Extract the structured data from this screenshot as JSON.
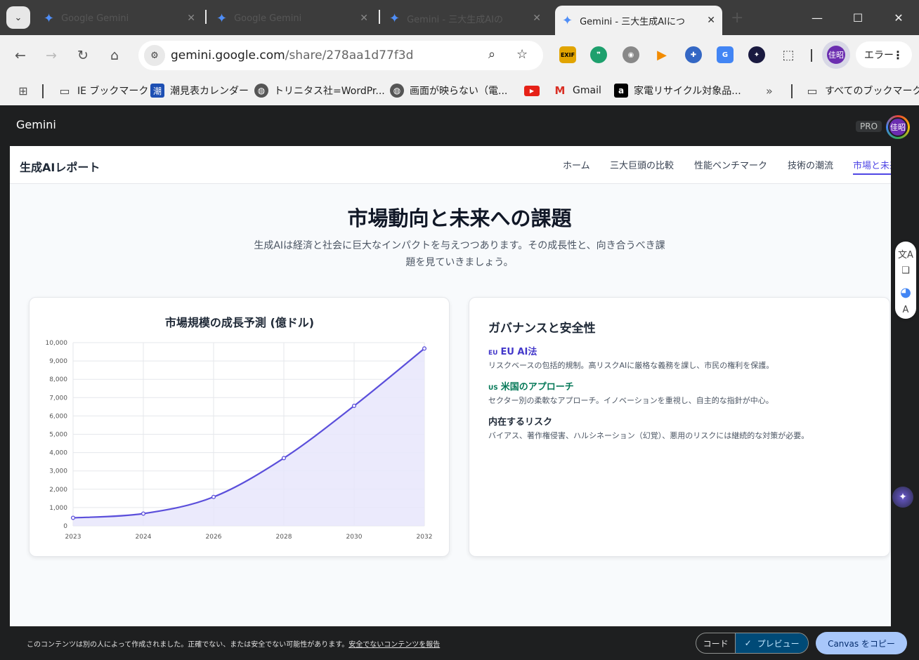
{
  "browser": {
    "tabs": [
      {
        "title": "Google Gemini",
        "active": false
      },
      {
        "title": "Google Gemini",
        "active": false
      },
      {
        "title": "Gemini - 三大生成AIの",
        "active": false
      },
      {
        "title": "Gemini - 三大生成AIにつ",
        "active": true
      }
    ],
    "url_host": "gemini.google.com",
    "url_path": "/share/278aa1d77f3d",
    "profile_initials": "佳昭",
    "error_label": "エラー",
    "extensions": [
      "EXIF",
      "❞",
      "◉",
      "▶",
      "✚",
      "G",
      "✦",
      "⬚"
    ]
  },
  "bookmarks": [
    {
      "icon": "folder-icon",
      "label": "IE ブックマーク"
    },
    {
      "icon": "tide-icon",
      "glyph": "潮",
      "label": "潮見表カレンダー"
    },
    {
      "icon": "globe-icon",
      "label": "トリニタス社=WordPr..."
    },
    {
      "icon": "globe-icon",
      "label": "画面が映らない（電..."
    },
    {
      "icon": "youtube-icon",
      "label": ""
    },
    {
      "icon": "gmail-icon",
      "label": "Gmail"
    },
    {
      "icon": "amazon-icon",
      "glyph": "a",
      "label": "家電リサイクル対象品..."
    },
    {
      "icon": "folder-icon",
      "label": "すべてのブックマーク"
    }
  ],
  "app": {
    "title": "Gemini",
    "badge": "PRO",
    "avatar": "佳昭"
  },
  "canvas": {
    "brand": "生成AIレポート",
    "nav": [
      "ホーム",
      "三大巨頭の比較",
      "性能ベンチマーク",
      "技術の潮流",
      "市場と未来"
    ],
    "active_nav": 4,
    "heading": "市場動向と未来への課題",
    "subtitle_line1": "生成AIは経済と社会に巨大なインパクトを与えつつあります。その成長性と、向き合うべき課",
    "subtitle_line2": "題を見ていきましょう。",
    "chart_title": "市場規模の成長予測 (億ドル)",
    "governance": {
      "title": "ガバナンスと安全性",
      "items": [
        {
          "flag": "EU",
          "heading": "EU AI法",
          "body": "リスクベースの包括的規制。高リスクAIに厳格な義務を課し、市民の権利を保護。",
          "color": "#4338ca"
        },
        {
          "flag": "US",
          "heading": "米国のアプローチ",
          "body": "セクター別の柔軟なアプローチ。イノベーションを重視し、自主的な指針が中心。",
          "color": "#047857"
        },
        {
          "flag": "",
          "heading": "内在するリスク",
          "body": "バイアス、著作権侵害、ハルシネーション（幻覚）、悪用のリスクには継続的な対策が必要。",
          "color": "#1f2937"
        }
      ]
    }
  },
  "chart_data": {
    "type": "area",
    "title": "市場規模の成長予測 (億ドル)",
    "categories": [
      "2023",
      "2024",
      "2026",
      "2028",
      "2030",
      "2032"
    ],
    "values": [
      440,
      670,
      1580,
      3700,
      6550,
      9680
    ],
    "ylim": [
      0,
      10000
    ],
    "yticks": [
      "0",
      "1,000",
      "2,000",
      "3,000",
      "4,000",
      "5,000",
      "6,000",
      "7,000",
      "8,000",
      "9,000",
      "10,000"
    ],
    "grid": true,
    "line_color": "#5b4fdb",
    "fill_color": "#e8e6fb"
  },
  "banner": {
    "text": "このコンテンツは別の人によって作成されました。正確でない、または安全でない可能性があります。",
    "link": "安全でないコンテンツを報告",
    "code_label": "コード",
    "preview_label": "プレビュー",
    "copy_label": "Canvas をコピー"
  }
}
